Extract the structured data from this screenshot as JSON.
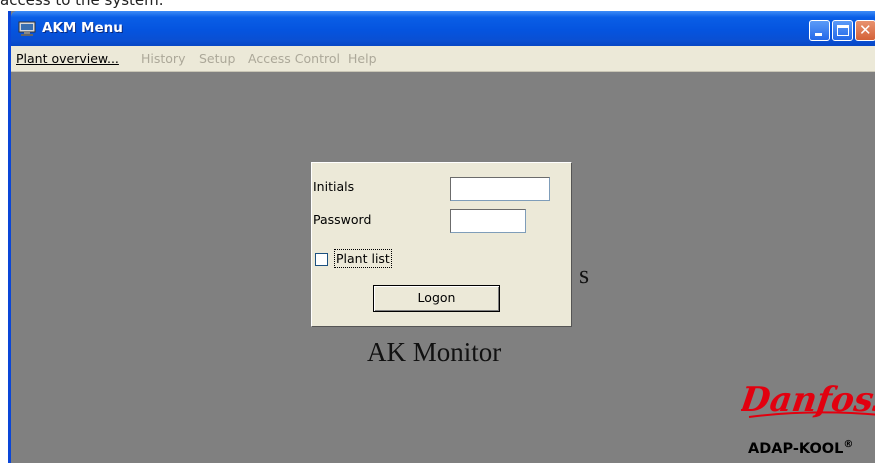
{
  "page_caption": "access to the system.",
  "window": {
    "title": "AKM Menu",
    "icon": "computer-icon",
    "controls": {
      "minimize": "minimize-icon",
      "maximize": "maximize-icon",
      "close": "close-icon"
    }
  },
  "menubar": {
    "items": [
      {
        "label": "Plant overview...",
        "enabled": true
      },
      {
        "label": "History",
        "enabled": false
      },
      {
        "label": "Setup",
        "enabled": false
      },
      {
        "label": "Access Control",
        "enabled": false
      },
      {
        "label": "Help",
        "enabled": false
      }
    ]
  },
  "background": {
    "partial_text": "s",
    "app_name": "AK Monitor"
  },
  "branding": {
    "logo": "Danfoss",
    "logo_color": "#e2000f",
    "product": "ADAP-KOOL",
    "trademark": "®"
  },
  "login_dialog": {
    "initials_label": "Initials",
    "initials_value": "",
    "password_label": "Password",
    "password_value": "",
    "plant_list_label": "Plant list",
    "plant_list_checked": false,
    "logon_label": "Logon"
  }
}
